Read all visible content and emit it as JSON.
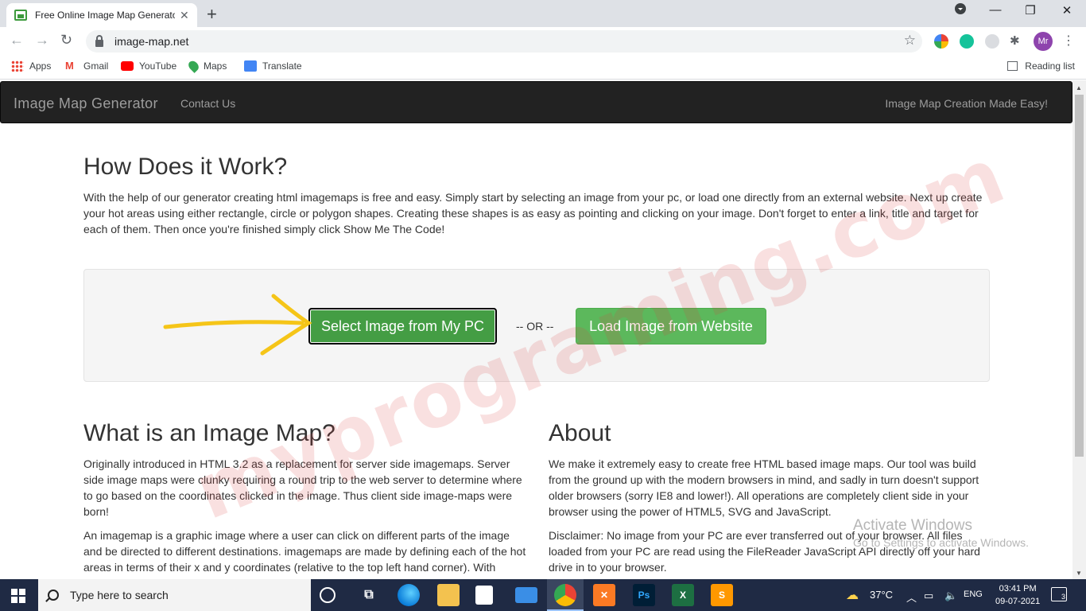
{
  "browser": {
    "tab_title": "Free Online Image Map Generato",
    "url": "image-map.net",
    "avatar_initials": "Mr",
    "bookmarks": [
      {
        "label": "Apps"
      },
      {
        "label": "Gmail"
      },
      {
        "label": "YouTube"
      },
      {
        "label": "Maps"
      },
      {
        "label": "Translate"
      }
    ],
    "reading_list": "Reading list"
  },
  "site": {
    "brand": "Image Map Generator",
    "nav_contact": "Contact Us",
    "tagline": "Image Map Creation Made Easy!"
  },
  "how": {
    "title": "How Does it Work?",
    "text": "With the help of our generator creating html imagemaps is free and easy. Simply start by selecting an image from your pc, or load one directly from an external website. Next up create your hot areas using either rectangle, circle or polygon shapes. Creating these shapes is as easy as pointing and clicking on your image. Don't forget to enter a link, title and target for each of them. Then once you're finished simply click Show Me The Code!"
  },
  "actions": {
    "select_label": "Select Image from My PC",
    "or_label": "-- OR --",
    "load_label": "Load Image from Website"
  },
  "what": {
    "title": "What is an Image Map?",
    "p1": "Originally introduced in HTML 3.2 as a replacement for server side imagemaps. Server side image maps were clunky requiring a round trip to the web server to determine where to go based on the coordinates clicked in the image. Thus client side image-maps were born!",
    "p2": "An imagemap is a graphic image where a user can click on different parts of the image and be directed to different destinations. imagemaps are made by defining each of the hot areas in terms of their x and y coordinates (relative to the top left hand corner). With"
  },
  "about": {
    "title": "About",
    "p1": "We make it extremely easy to create free HTML based image maps. Our tool was build from the ground up with the modern browsers in mind, and sadly in turn doesn't support older browsers (sorry IE8 and lower!). All operations are completely client side in your browser using the power of HTML5, SVG and JavaScript.",
    "p2": "Disclaimer: No image from your PC are ever transferred out of your browser. All files loaded from your PC are read using the FileReader JavaScript API directly off your hard drive in to your browser."
  },
  "overlay": {
    "watermark": "myprograming.com",
    "activate_line1": "Activate Windows",
    "activate_line2": "Go to Settings to activate Windows."
  },
  "taskbar": {
    "search_placeholder": "Type here to search",
    "temperature": "37°C",
    "language": "ENG",
    "time": "03:41 PM",
    "date": "09-07-2021",
    "notification_count": "3"
  },
  "colors": {
    "select_button": "#449d44",
    "load_button": "#5cb85c",
    "navbar": "#222222",
    "taskbar": "#1f2a44"
  }
}
